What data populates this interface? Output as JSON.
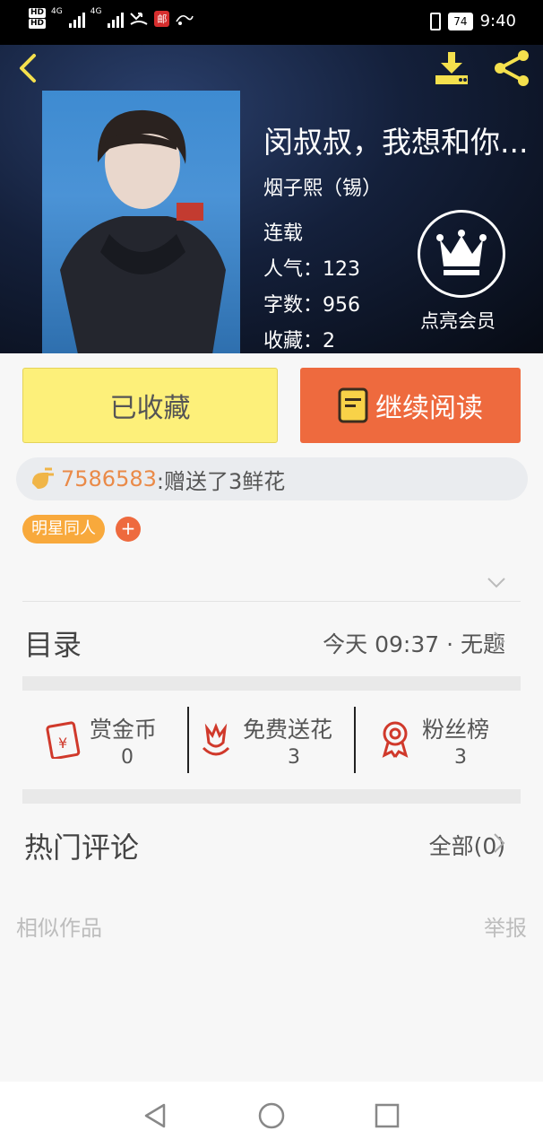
{
  "status_bar": {
    "hd1": "HD",
    "hd2": "HD",
    "net1": "4G",
    "net2": "4G",
    "mail_badge": "邮",
    "battery": "74",
    "time": "9:40"
  },
  "header": {
    "title": "闵叔叔，我想和你...",
    "author": "烟子熙（锡）",
    "status": "连载",
    "stats": [
      {
        "label": "人气：",
        "value": "123"
      },
      {
        "label": "字数：",
        "value": "956"
      },
      {
        "label": "收藏：",
        "value": "2"
      }
    ],
    "vip_label": "点亮会员"
  },
  "actions": {
    "favorite_label": "已收藏",
    "read_label": "继续阅读"
  },
  "gift": {
    "user": "7586583",
    "text": ":赠送了3鲜花"
  },
  "tags": [
    "明星同人"
  ],
  "tag_add": "+",
  "catalog": {
    "title": "目录",
    "latest": "今天 09:37 · 无题"
  },
  "stats_row": [
    {
      "name": "赏金币",
      "value": "0",
      "icon": "red-envelope-icon"
    },
    {
      "name": "免费送花",
      "value": "3",
      "icon": "flower-icon"
    },
    {
      "name": "粉丝榜",
      "value": "3",
      "icon": "medal-icon"
    }
  ],
  "comments": {
    "title": "热门评论",
    "all_label": "全部(0)"
  },
  "footer": {
    "similar": "相似作品",
    "report": "举报"
  },
  "colors": {
    "accent_orange": "#ee6a3e",
    "favorite_yellow": "#fdf07a",
    "icon_yellow": "#f4e04d",
    "tag_orange": "#f8a93c",
    "icon_red": "#d0392b"
  }
}
